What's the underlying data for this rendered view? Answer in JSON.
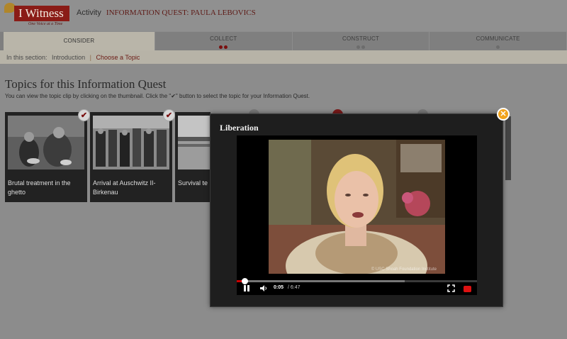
{
  "header": {
    "logo_text": "I Witness",
    "logo_tagline": "One Voice at a Time",
    "activity_label": "Activity",
    "activity_name": "INFORMATION QUEST: PAULA LEBOVICS"
  },
  "steps": [
    {
      "label": "CONSIDER",
      "active": true
    },
    {
      "label": "COLLECT",
      "dots": "red"
    },
    {
      "label": "CONSTRUCT",
      "dots": "grey"
    },
    {
      "label": "COMMUNICATE",
      "dots": "grey-single"
    }
  ],
  "section_bar": {
    "prefix": "In this section:",
    "items": [
      "Introduction",
      "Choose a Topic"
    ],
    "separator": "|"
  },
  "page": {
    "title": "Topics for this Information Quest",
    "instructions": "You can view the topic clip by clicking on the thumbnail. Click the \"✔\" button to select the topic for your Information Quest."
  },
  "topics": [
    {
      "label": "Brutal treatment in the ghetto",
      "check": "✔"
    },
    {
      "label": "Arrival at Auschwitz II-Birkenau",
      "check": "✔"
    },
    {
      "label": "Survival te",
      "check": ""
    }
  ],
  "modal": {
    "title": "Liberation",
    "close_icon": "close-icon",
    "watermark": "© USC Shoah Foundation Institute",
    "time_current": "0:05",
    "time_total": "/ 6:47",
    "progress_fraction": 0.03,
    "buffer_fraction": 0.7
  },
  "colors": {
    "brand_red": "#8a1c17",
    "accent_orange": "#f2a31b",
    "progress_red": "#cc0000"
  }
}
